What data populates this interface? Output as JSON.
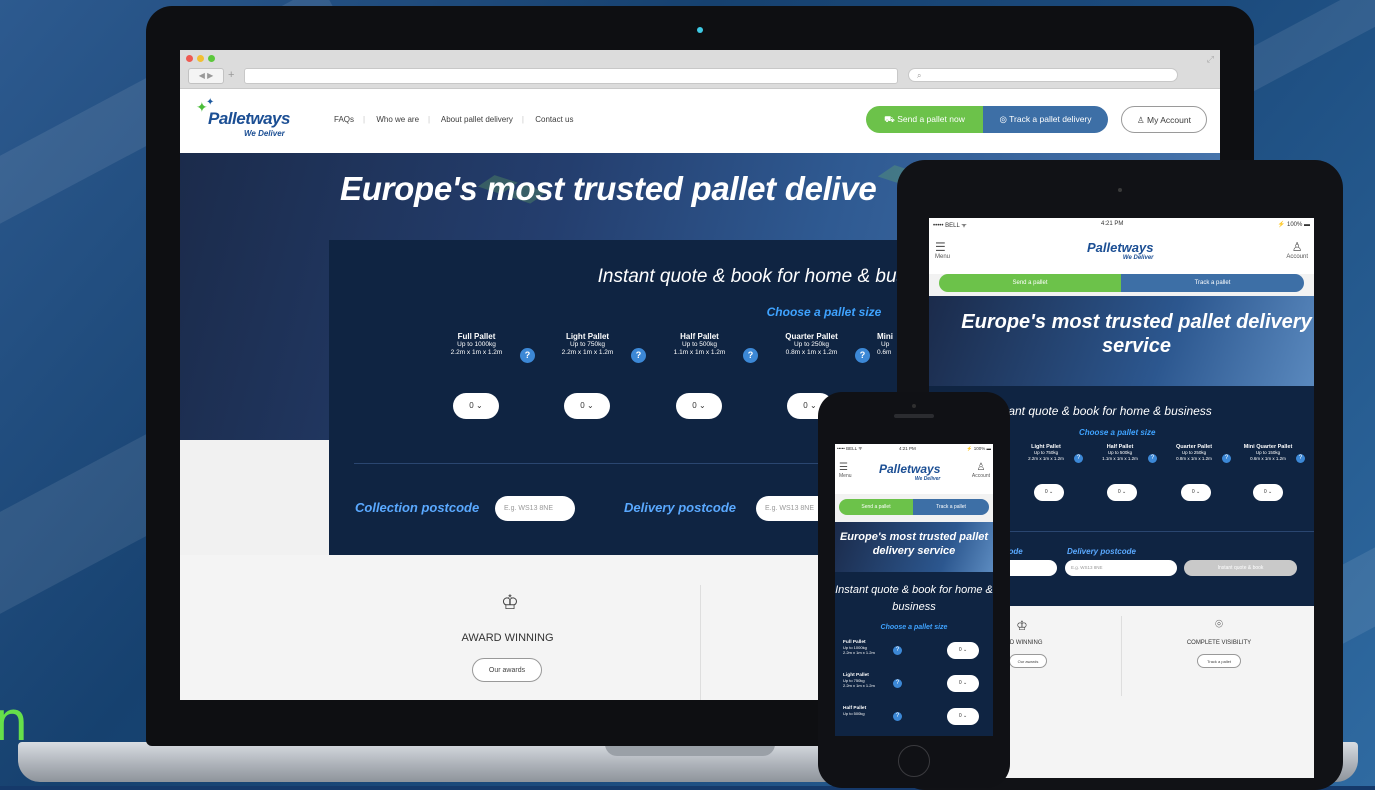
{
  "background": {
    "accent_text": "n"
  },
  "browser": {
    "nav_arrows": "◀ ▶",
    "new_tab": "+",
    "search_icon": "⌕",
    "resize_icon": "⤢"
  },
  "site": {
    "logo": {
      "name": "Palletways",
      "tagline": "We Deliver"
    },
    "nav": [
      "FAQs",
      "Who we are",
      "About pallet delivery",
      "Contact us"
    ],
    "buttons": {
      "send": "Send a pallet now",
      "track": "Track a pallet delivery",
      "account": "My Account"
    },
    "hero_title": "Europe's most trusted pallet delive",
    "quote": {
      "heading": "Instant quote & book for home & business",
      "choose": "Choose a pallet size",
      "pallets": [
        {
          "title": "Full Pallet",
          "weight": "Up to 1000kg",
          "size": "2.2m x 1m x 1.2m"
        },
        {
          "title": "Light Pallet",
          "weight": "Up to 750kg",
          "size": "2.2m x 1m x 1.2m"
        },
        {
          "title": "Half Pallet",
          "weight": "Up to 500kg",
          "size": "1.1m x 1m x 1.2m"
        },
        {
          "title": "Quarter Pallet",
          "weight": "Up to 250kg",
          "size": "0.8m x 1m x 1.2m"
        },
        {
          "title": "Mini",
          "weight": "Up",
          "size": "0.6m"
        }
      ],
      "qty_value": "0",
      "collection_label": "Collection postcode",
      "collection_placeholder": "E.g. WS13 8NE",
      "delivery_label": "Delivery postcode",
      "delivery_placeholder": "E.g. WS13 8NE"
    },
    "features": {
      "award_title": "AWARD WINNING",
      "award_button": "Our awards"
    }
  },
  "tablet": {
    "status": {
      "carrier": "••••• BELL ᯤ",
      "time": "4:21 PM",
      "battery": "⚡ 100% ▬"
    },
    "menu": "Menu",
    "account": "Account",
    "logo": {
      "name": "Palletways",
      "tagline": "We Deliver"
    },
    "send": "Send a pallet",
    "track": "Track a pallet",
    "hero_title": "Europe's most trusted pallet delivery service",
    "quote_heading": "stant quote & book for home & business",
    "choose": "Choose a pallet size",
    "pallets": [
      {
        "title": "Light Pallet",
        "weight": "Up to 750kg",
        "size": "2.2m x 1m x 1.2m"
      },
      {
        "title": "Half Pallet",
        "weight": "Up to 500kg",
        "size": "1.1m x 1m x 1.2m"
      },
      {
        "title": "Quarter Pallet",
        "weight": "Up to 250kg",
        "size": "0.8m x 1m x 1.2m"
      },
      {
        "title": "Mini Quarter Pallet",
        "weight": "Up to 150kg",
        "size": "0.6m x 1m x 1.2m"
      }
    ],
    "qty_value": "0",
    "collection_label": "code",
    "delivery_label": "Delivery postcode",
    "delivery_placeholder": "E.g. WS13 8NE",
    "quote_button": "Instant quote & book",
    "features": {
      "award_title": "RD WINNING",
      "award_button": "Our awards",
      "visibility_title": "COMPLETE VISIBILITY",
      "visibility_button": "Track a pallet"
    }
  },
  "phone": {
    "status": {
      "carrier": "••••• BELL ᯤ",
      "time": "4:21 PM",
      "battery": "⚡ 100% ▬"
    },
    "menu": "Menu",
    "account": "Account",
    "logo": {
      "name": "Palletways",
      "tagline": "We Deliver"
    },
    "send": "Send a pallet",
    "track": "Track a pallet",
    "hero_title": "Europe's most trusted pallet delivery service",
    "quote_heading": "Instant quote & book for home & business",
    "choose": "Choose a pallet size",
    "pallets": [
      {
        "title": "Full Pallet",
        "weight": "Up to 1000kg",
        "size": "2.2m x 1m x 1.2m"
      },
      {
        "title": "Light Pallet",
        "weight": "Up to 750kg",
        "size": "2.2m x 1m x 1.2m"
      },
      {
        "title": "Half Pallet",
        "weight": "Up to 500kg",
        "size": ""
      }
    ],
    "qty_value": "0"
  },
  "icons": {
    "question": "?",
    "chevron": "⌄",
    "trophy": "🏆",
    "pin": "⌾",
    "truck": "⛟",
    "location": "◎",
    "user": "♙",
    "menu": "☰"
  },
  "colors": {
    "brand_blue": "#1c4f94",
    "brand_green": "#6cc24a",
    "track_blue": "#3d6fa6",
    "quote_navy": "#0f2442",
    "accent_light_blue": "#3fa3ff"
  }
}
